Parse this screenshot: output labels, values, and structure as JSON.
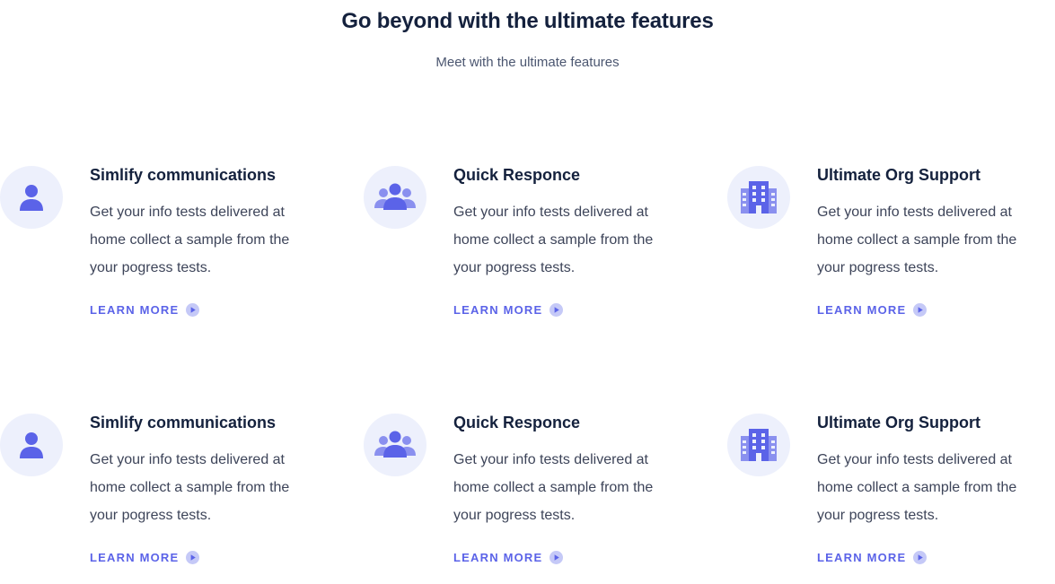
{
  "header": {
    "title": "Go beyond with the ultimate features",
    "subtitle": "Meet with the ultimate features"
  },
  "colors": {
    "accent": "#5b63e8",
    "icon_bg": "#edf0fc",
    "heading": "#14213d",
    "body": "#3d4459"
  },
  "features": [
    {
      "icon": "user-icon",
      "title": "Simlify communications",
      "description": "Get your info tests delivered at home collect a sample from the your pogress tests.",
      "link_label": "LEARN MORE"
    },
    {
      "icon": "group-icon",
      "title": "Quick Responce",
      "description": "Get your info tests delivered at home collect a sample from the your pogress tests.",
      "link_label": "LEARN MORE"
    },
    {
      "icon": "building-icon",
      "title": "Ultimate Org Support",
      "description": "Get your info tests delivered at home collect a sample from the your pogress tests.",
      "link_label": "LEARN MORE"
    },
    {
      "icon": "user-icon",
      "title": "Simlify communications",
      "description": "Get your info tests delivered at home collect a sample from the your pogress tests.",
      "link_label": "LEARN MORE"
    },
    {
      "icon": "group-icon",
      "title": "Quick Responce",
      "description": "Get your info tests delivered at home collect a sample from the your pogress tests.",
      "link_label": "LEARN MORE"
    },
    {
      "icon": "building-icon",
      "title": "Ultimate Org Support",
      "description": "Get your info tests delivered at home collect a sample from the your pogress tests.",
      "link_label": "LEARN MORE"
    }
  ]
}
